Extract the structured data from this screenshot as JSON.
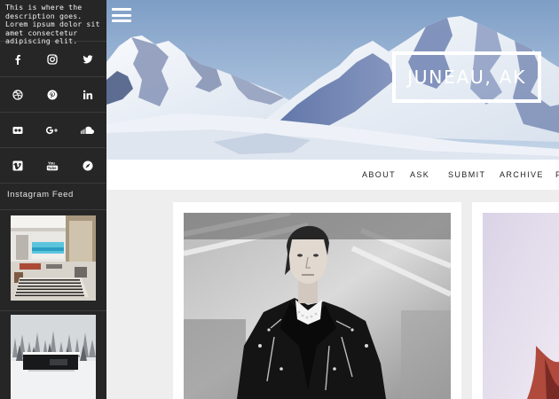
{
  "sidebar": {
    "description": "This is where the description goes. Lorem ipsum dolor sit amet consectetur adipiscing elit.",
    "social_icons": [
      "facebook-icon",
      "instagram-icon",
      "twitter-icon",
      "dribbble-icon",
      "pinterest-icon",
      "linkedin-icon",
      "flickr-icon",
      "google-plus-icon",
      "soundcloud-icon",
      "vimeo-icon",
      "youtube-icon",
      "behance-icon"
    ],
    "instagram_title": "Instagram Feed"
  },
  "header": {
    "title": "JUNEAU, AK",
    "menu_icon": "hamburger-menu-icon"
  },
  "nav": {
    "items": [
      "ABOUT",
      "ASK",
      "SUBMIT",
      "ARCHIVE",
      "F"
    ]
  },
  "colors": {
    "sidebar_bg": "#262626",
    "page_bg": "#eeeeee",
    "card_bg": "#ffffff",
    "sky": "#8aa7cc"
  }
}
